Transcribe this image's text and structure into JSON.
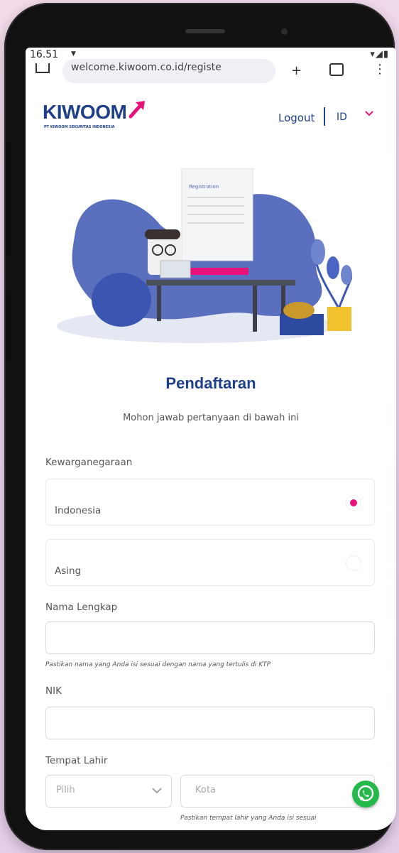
{
  "status_bar": {
    "time": "16.51"
  },
  "browser": {
    "url": "welcome.kiwoom.co.id/registe"
  },
  "header": {
    "logo_text": "KIWOOM",
    "logo_subtext": "PT KIWOOM SEKURITAS INDONESIA",
    "logout_label": "Logout",
    "language": "ID"
  },
  "illustration": {
    "card_title": "Registration"
  },
  "form": {
    "title": "Pendaftaran",
    "subtitle": "Mohon jawab pertanyaan di bawah ini",
    "citizenship": {
      "label": "Kewarganegaraan",
      "options": [
        {
          "label": "Indonesia",
          "selected": true
        },
        {
          "label": "Asing",
          "selected": false
        }
      ]
    },
    "full_name": {
      "label": "Nama Lengkap",
      "value": "",
      "hint": "Pastikan nama yang Anda isi sesuai dengan nama yang tertulis di KTP"
    },
    "nik": {
      "label": "NIK",
      "value": ""
    },
    "birthplace": {
      "label": "Tempat Lahir",
      "select_value": "Pilih",
      "city_placeholder": "Kota",
      "hint": "Pastikan tempat lahir yang Anda isi sesuai"
    }
  },
  "colors": {
    "brand_blue": "#1e3f8a",
    "accent_pink": "#e8127a",
    "whatsapp_green": "#25b84a"
  },
  "icons": [
    "home-icon",
    "plus-icon",
    "tabs-icon",
    "menu-icon",
    "chevron-down-icon",
    "whatsapp-icon"
  ]
}
